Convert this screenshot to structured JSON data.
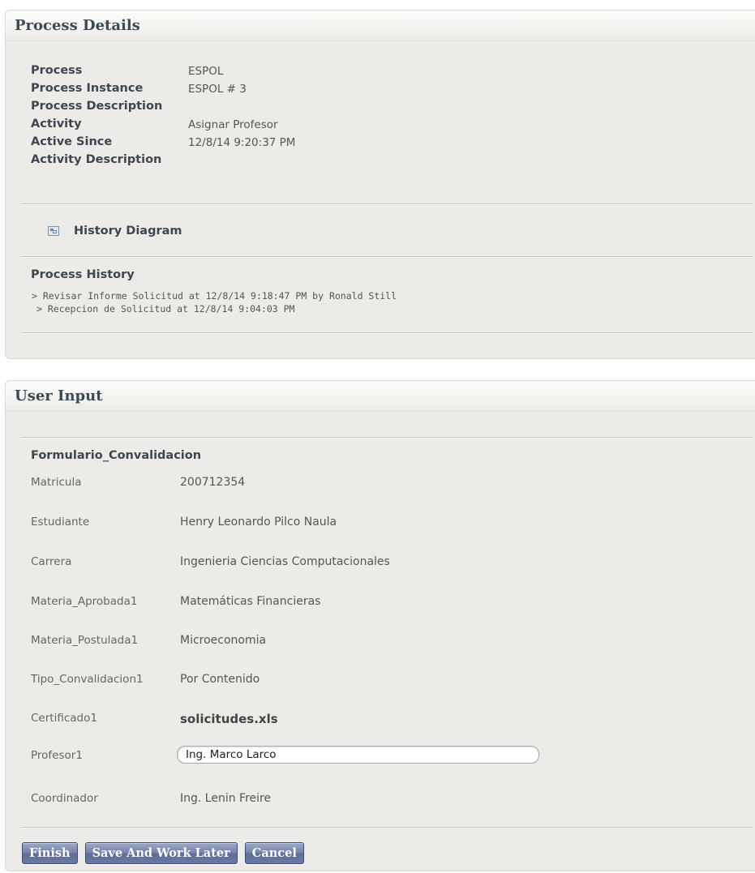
{
  "process_details": {
    "title": "Process Details",
    "fields": [
      {
        "label": "Process",
        "value": "ESPOL"
      },
      {
        "label": "Process Instance",
        "value": "ESPOL # 3"
      },
      {
        "label": "Process Description",
        "value": ""
      },
      {
        "label": "Activity",
        "value": "Asignar Profesor"
      },
      {
        "label": "Active Since",
        "value": "12/8/14 9:20:37 PM"
      },
      {
        "label": "Activity Description",
        "value": ""
      }
    ],
    "history_diagram_label": "History Diagram",
    "history_title": "Process History",
    "history": [
      "> Revisar Informe Solicitud at 12/8/14 9:18:47 PM by Ronald Still",
      "> Recepcion de Solicitud at 12/8/14 9:04:03 PM"
    ]
  },
  "user_input": {
    "title": "User Input",
    "form_title": "Formulario_Convalidacion",
    "fields": [
      {
        "label": "Matricula",
        "value": "200712354"
      },
      {
        "label": "Estudiante",
        "value": "Henry Leonardo Pilco Naula"
      },
      {
        "label": "Carrera",
        "value": "Ingenieria Ciencias Computacionales"
      },
      {
        "label": "Materia_Aprobada1",
        "value": "Matemáticas Financieras"
      },
      {
        "label": "Materia_Postulada1",
        "value": "Microeconomia"
      },
      {
        "label": "Tipo_Convalidacion1",
        "value": "Por Contenido"
      },
      {
        "label": "Certificado1",
        "value": "solicitudes.xls"
      },
      {
        "label": "Profesor1",
        "value": "Ing. Marco Larco"
      },
      {
        "label": "Coordinador",
        "value": "Ing. Lenin Freire"
      }
    ],
    "buttons": {
      "finish": "Finish",
      "save_later": "Save And Work Later",
      "cancel": "Cancel"
    }
  }
}
